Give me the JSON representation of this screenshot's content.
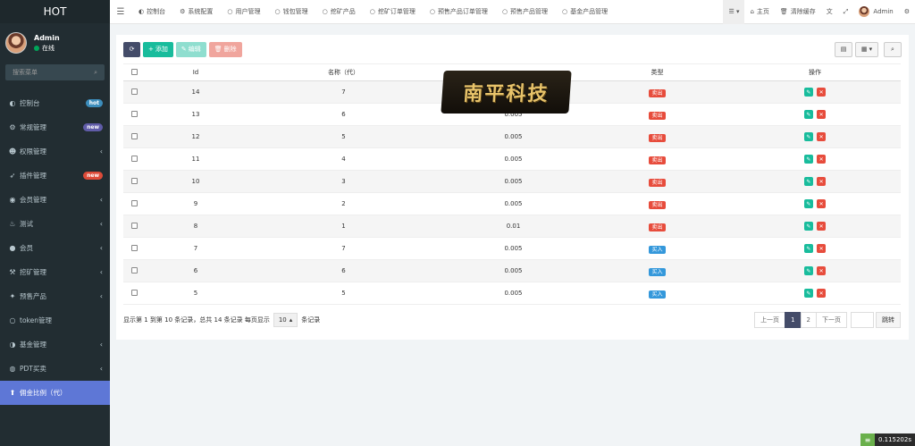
{
  "brand": "HOT",
  "user": {
    "name": "Admin",
    "status": "在线"
  },
  "search": {
    "placeholder": "搜索菜单"
  },
  "sidebar": {
    "items": [
      {
        "icon": "dashboard-icon",
        "glyph": "◐",
        "label": "控制台",
        "badge": "hot",
        "badge_class": "b-hot"
      },
      {
        "icon": "cogs-icon",
        "glyph": "⚙",
        "label": "常规管理",
        "badge": "new",
        "badge_class": "b-new1"
      },
      {
        "icon": "group-icon",
        "glyph": "☻",
        "label": "权限管理",
        "chev": "‹"
      },
      {
        "icon": "rocket-icon",
        "glyph": "➶",
        "label": "插件管理",
        "badge": "new",
        "badge_class": "b-new2"
      },
      {
        "icon": "user-circle-icon",
        "glyph": "◉",
        "label": "会员管理",
        "chev": "‹"
      },
      {
        "icon": "flask-icon",
        "glyph": "♨",
        "label": "测试",
        "chev": "‹"
      },
      {
        "icon": "circle-icon",
        "glyph": "●",
        "label": "会员",
        "chev": "‹"
      },
      {
        "icon": "pickaxe-icon",
        "glyph": "⚒",
        "label": "挖矿管理",
        "chev": "‹"
      },
      {
        "icon": "gift-icon",
        "glyph": "✦",
        "label": "预售产品",
        "chev": "‹"
      },
      {
        "icon": "circle-o-icon",
        "glyph": "○",
        "label": "token管理"
      },
      {
        "icon": "adjust-icon",
        "glyph": "◑",
        "label": "基金管理",
        "chev": "‹"
      },
      {
        "icon": "trade-icon",
        "glyph": "◍",
        "label": "PDT买卖",
        "chev": "‹"
      },
      {
        "icon": "arrow-up-icon",
        "glyph": "⬆",
        "label": "佣金比例（代）",
        "active": true
      }
    ]
  },
  "topnav": {
    "tabs": [
      {
        "icon": "dashboard-icon",
        "glyph": "◐",
        "label": "控制台"
      },
      {
        "icon": "cog-icon",
        "glyph": "⚙",
        "label": "系统配置"
      },
      {
        "icon": "circle-o-icon",
        "glyph": "○",
        "label": "用户管理"
      },
      {
        "icon": "circle-o-icon",
        "glyph": "○",
        "label": "钱包管理"
      },
      {
        "icon": "circle-o-icon",
        "glyph": "○",
        "label": "挖矿产品"
      },
      {
        "icon": "circle-o-icon",
        "glyph": "○",
        "label": "挖矿订单管理"
      },
      {
        "icon": "circle-o-icon",
        "glyph": "○",
        "label": "预售产品订单管理"
      },
      {
        "icon": "circle-o-icon",
        "glyph": "○",
        "label": "预售产品管理"
      },
      {
        "icon": "circle-o-icon",
        "glyph": "○",
        "label": "基金产品管理"
      }
    ],
    "home": "主页",
    "clear_cache": "清除缓存",
    "admin": "Admin"
  },
  "toolbar": {
    "add": "添加",
    "edit": "编辑",
    "delete": "删除"
  },
  "table": {
    "headers": [
      "Id",
      "名称（代）",
      "",
      "类型",
      "操作"
    ],
    "rows": [
      {
        "id": "14",
        "name": "7",
        "rate": "",
        "type": "卖出",
        "kind": "sell"
      },
      {
        "id": "13",
        "name": "6",
        "rate": "0.005",
        "type": "卖出",
        "kind": "sell"
      },
      {
        "id": "12",
        "name": "5",
        "rate": "0.005",
        "type": "卖出",
        "kind": "sell"
      },
      {
        "id": "11",
        "name": "4",
        "rate": "0.005",
        "type": "卖出",
        "kind": "sell"
      },
      {
        "id": "10",
        "name": "3",
        "rate": "0.005",
        "type": "卖出",
        "kind": "sell"
      },
      {
        "id": "9",
        "name": "2",
        "rate": "0.005",
        "type": "卖出",
        "kind": "sell"
      },
      {
        "id": "8",
        "name": "1",
        "rate": "0.01",
        "type": "卖出",
        "kind": "sell"
      },
      {
        "id": "7",
        "name": "7",
        "rate": "0.005",
        "type": "买入",
        "kind": "buy"
      },
      {
        "id": "6",
        "name": "6",
        "rate": "0.005",
        "type": "买入",
        "kind": "buy"
      },
      {
        "id": "5",
        "name": "5",
        "rate": "0.005",
        "type": "买入",
        "kind": "buy"
      }
    ]
  },
  "watermark": "南平科技",
  "footer": {
    "summary": "显示第 1 到第 10 条记录，总共 14 条记录 每页显示",
    "page_size": "10",
    "suffix": "条记录",
    "prev": "上一页",
    "pages": [
      "1",
      "2"
    ],
    "next": "下一页",
    "jump": "跳转"
  },
  "timer": "0.115202s"
}
